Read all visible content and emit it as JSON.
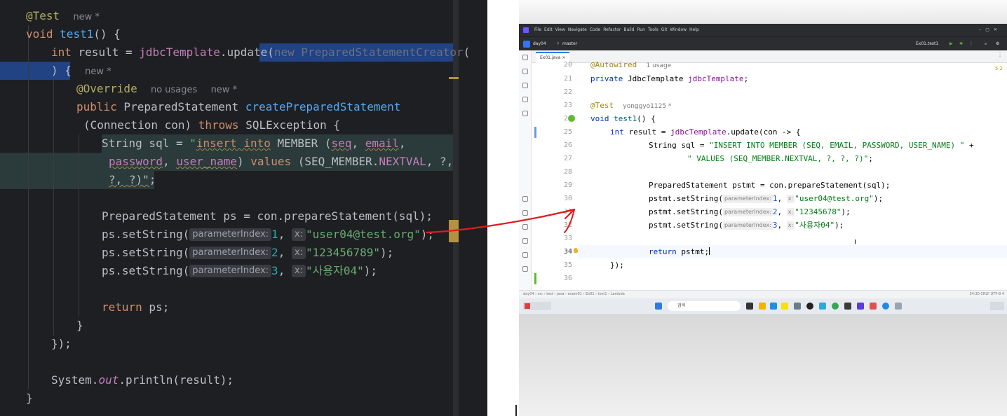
{
  "left_editor": {
    "lines": [
      {
        "ann": "@Test",
        "meta": "new *"
      },
      {
        "kw": "void",
        "fn": "test1",
        "rest": "() {"
      },
      {
        "kw": "int",
        "pre": " result = ",
        "fn": "jdbcTemplate",
        "mid": ".update(",
        "sel": "new PreparedStatementCreator",
        "post": "("
      },
      {
        "pre": ")",
        "post": " {",
        "meta": "new *"
      },
      {
        "ann": "@Override",
        "meta1": "no usages",
        "meta2": "new *"
      },
      {
        "kw": "public",
        "pre": " PreparedStatement ",
        "fn": "createPreparedStatement"
      },
      {
        "pre": "(Connection con) ",
        "kw": "throws",
        "post": " SQLException {"
      },
      {
        "pre": "String sql = ",
        "str1": "\"",
        "sq1": "insert into",
        "s1": " MEMBER (",
        "sq2": "seq",
        "s2": ", ",
        "sq3": "email",
        "s3": ","
      },
      {
        "sq4": "password",
        "s4": ", ",
        "sq5": "user_name",
        "s5": ") ",
        "sq6": "values",
        "s6": " (SEQ_MEMBER.",
        "p1": "NEXTVAL",
        "s7": ", ?, "
      },
      {
        "s8": "?, ?)\"",
        "post": ";"
      },
      {
        "pre": "PreparedStatement ps = con.prepareStatement(sql);"
      },
      {
        "pre": "ps.setString(",
        "hint1": "parameterIndex:",
        "num": "1",
        "mid": ", ",
        "hint2": "x:",
        "str": "\"user04@test.org\"",
        "post": ");"
      },
      {
        "pre": "ps.setString(",
        "hint1": "parameterIndex:",
        "num": "2",
        "mid": ", ",
        "hint2": "x:",
        "str": "\"123456789\"",
        "post": ");"
      },
      {
        "pre": "ps.setString(",
        "hint1": "parameterIndex:",
        "num": "3",
        "mid": ", ",
        "hint2": "x:",
        "str": "\"사용자04\"",
        "post": ");"
      },
      {
        "kw": "return",
        "post": " ps;"
      },
      {
        "pre": "}"
      },
      {
        "pre": "});"
      },
      {
        "pre": "System.",
        "ital": "out",
        "post": ".println(result);"
      },
      {
        "pre": "}"
      }
    ]
  },
  "right_ide": {
    "menu": [
      "File",
      "Edit",
      "View",
      "Navigate",
      "Code",
      "Refactor",
      "Build",
      "Run",
      "Tools",
      "Git",
      "Window",
      "Help"
    ],
    "project": "day04",
    "branch": "master",
    "run_config": "Ex01.test1",
    "tab": "Ex01.java",
    "inspections": "5  2",
    "lines": {
      "n20": "20",
      "t20a": "@Autowired",
      "t20m": "1 usage",
      "n21": "21",
      "t21k": "private",
      "t21r": " JdbcTemplate ",
      "t21f": "jdbcTemplate",
      "t21e": ";",
      "n22": "22",
      "n23": "23",
      "t23a": "@Test",
      "t23m": "yonggyo1125 *",
      "n24": "24",
      "t24k": "void",
      "t24f": " test1",
      "t24r": "() {",
      "n25": "25",
      "t25k": "int",
      "t25r": " result = ",
      "t25f": "jdbcTemplate",
      "t25e": ".update(con -> {",
      "n26": "26",
      "t26r": "String sql = ",
      "t26s": "\"INSERT INTO MEMBER (SEQ, EMAIL, PASSWORD, USER_NAME) \"",
      "t26e": " +",
      "n27": "27",
      "t27s": "\" VALUES (SEQ_MEMBER.NEXTVAL, ?, ?, ?)\"",
      "t27e": ";",
      "n28": "28",
      "n29": "29",
      "t29": "PreparedStatement pstmt = con.prepareStatement(sql);",
      "n30": "30",
      "t30p": "pstmt.setString(",
      "t30h": "parameterIndex:",
      "t30n": "1",
      "t30m": ", ",
      "t30x": "x:",
      "t30s": "\"user04@test.org\"",
      "t30e": ");",
      "n31": "31",
      "t31p": "pstmt.setString(",
      "t31h": "parameterIndex:",
      "t31n": "2",
      "t31m": ", ",
      "t31x": "x:",
      "t31s": "\"12345678\"",
      "t31e": ");",
      "n32": "32",
      "t32p": "pstmt.setString(",
      "t32h": "parameterIndex:",
      "t32n": "3",
      "t32m": ", ",
      "t32x": "x:",
      "t32s": "\"사용자04\"",
      "t32e": ");",
      "n33": "33",
      "n34": "34",
      "t34k": "return",
      "t34r": " pstmt;",
      "n35": "35",
      "t35": "});",
      "n36": "36"
    },
    "breadcrumb": "day04 › src › test › java › exam01 › Ex01 › test1 › Lambda",
    "status_right": "34:30   CRLF   UTF-8   4",
    "taskbar_search": "검색"
  },
  "colors": {
    "left_bg": "#1e1f22",
    "arrow": "#e01b1b",
    "selection": "#214283"
  }
}
